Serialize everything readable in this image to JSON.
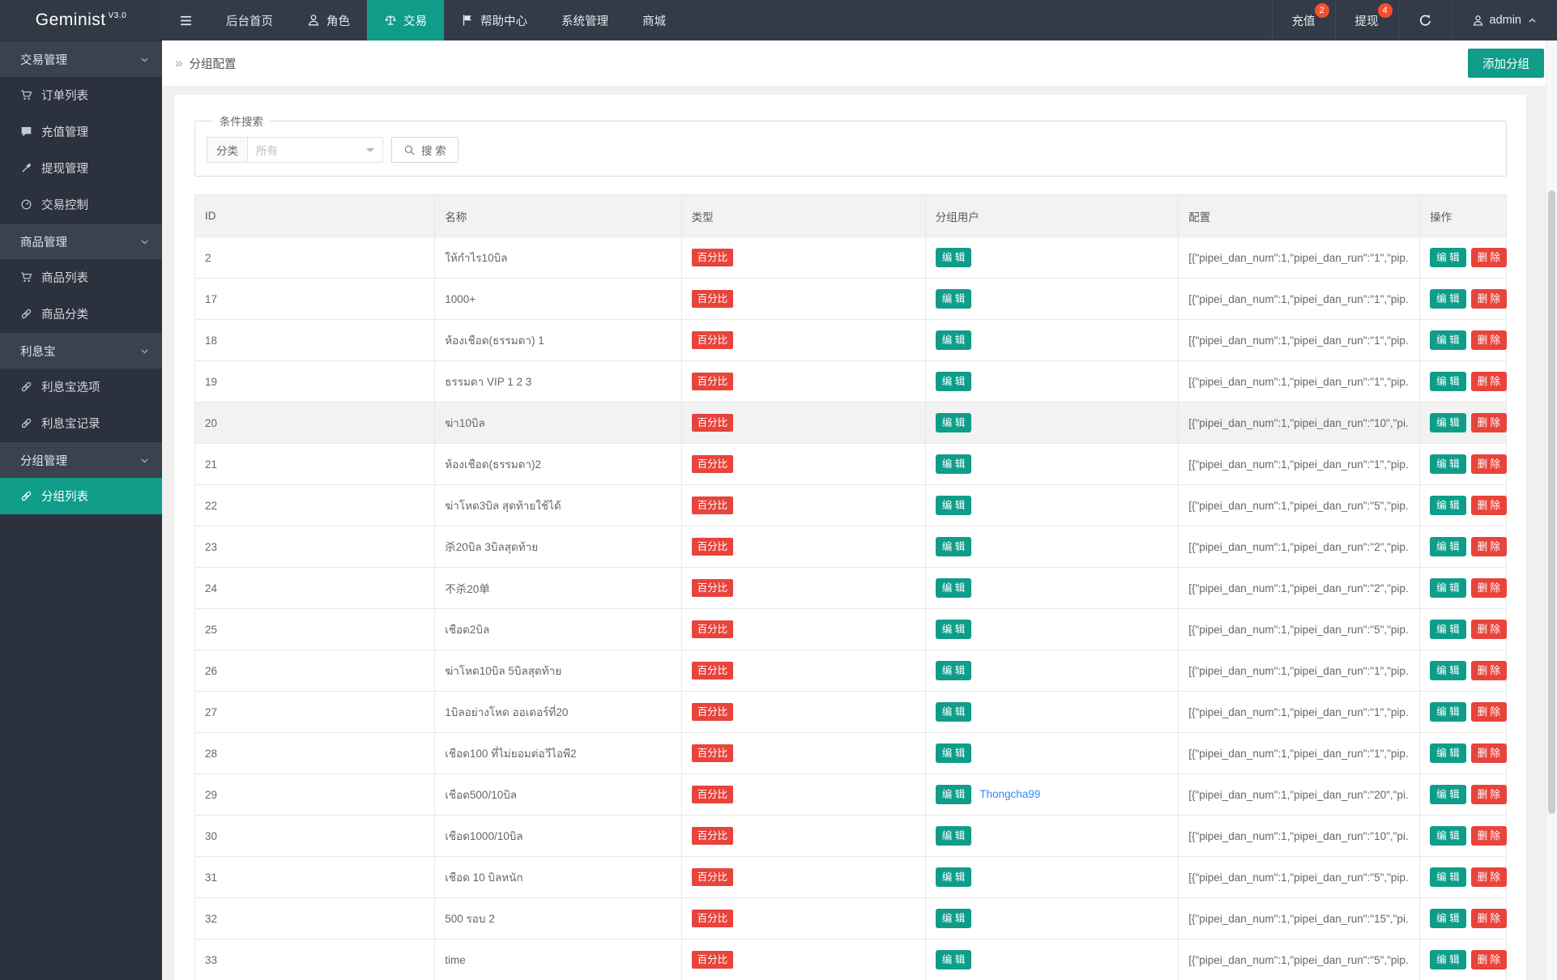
{
  "colors": {
    "accent_teal": "#0f9d8a",
    "danger_red": "#e8443c",
    "badge_orange": "#f4502c",
    "link_blue": "#2d8cf0"
  },
  "navbar": {
    "logo": "Geminist",
    "version": "V3.0",
    "menu": [
      {
        "key": "dashboard",
        "label": "后台首页",
        "icon": "",
        "active": false
      },
      {
        "key": "roles",
        "label": "角色",
        "icon": "user",
        "active": false
      },
      {
        "key": "trade",
        "label": "交易",
        "icon": "scales",
        "active": true
      },
      {
        "key": "help-center",
        "label": "帮助中心",
        "icon": "flag",
        "active": false
      },
      {
        "key": "system",
        "label": "系统管理",
        "icon": "",
        "active": false
      },
      {
        "key": "mall",
        "label": "商城",
        "icon": "",
        "active": false
      }
    ],
    "recharge_label": "充值",
    "recharge_badge": "2",
    "withdraw_label": "提现",
    "withdraw_badge": "4",
    "user": "admin"
  },
  "sidebar": {
    "groups": [
      {
        "key": "trade-mgmt",
        "title": "交易管理",
        "items": [
          {
            "key": "order-list",
            "label": "订单列表",
            "icon": "cart",
            "active": false
          },
          {
            "key": "recharge-mgmt",
            "label": "充值管理",
            "icon": "comment",
            "active": false
          },
          {
            "key": "withdraw-mgmt",
            "label": "提现管理",
            "icon": "gavel",
            "active": false
          },
          {
            "key": "trade-control",
            "label": "交易控制",
            "icon": "gauge",
            "active": false
          }
        ]
      },
      {
        "key": "goods-mgmt",
        "title": "商品管理",
        "items": [
          {
            "key": "goods-list",
            "label": "商品列表",
            "icon": "cart",
            "active": false
          },
          {
            "key": "goods-category",
            "label": "商品分类",
            "icon": "link",
            "active": false
          }
        ]
      },
      {
        "key": "lixibao",
        "title": "利息宝",
        "items": [
          {
            "key": "lixibao-options",
            "label": "利息宝选项",
            "icon": "link",
            "active": false
          },
          {
            "key": "lixibao-records",
            "label": "利息宝记录",
            "icon": "link",
            "active": false
          }
        ]
      },
      {
        "key": "group-mgmt",
        "title": "分组管理",
        "items": [
          {
            "key": "group-list",
            "label": "分组列表",
            "icon": "link",
            "active": true
          }
        ]
      }
    ]
  },
  "page": {
    "breadcrumb_arrow": "»",
    "breadcrumb": "分组配置",
    "add_button": "添加分组"
  },
  "search": {
    "legend": "条件搜索",
    "category_label": "分类",
    "category_value": "所有",
    "button_label": "搜 索"
  },
  "table": {
    "headers": [
      "ID",
      "名称",
      "类型",
      "分组用户",
      "配置",
      "操作"
    ],
    "col_widths_pct": [
      18.3,
      18.8,
      18.6,
      19.3,
      18.4,
      6.6
    ],
    "type_badge": "百分比",
    "edit_label": "编 辑",
    "delete_label": "删 除",
    "rows": [
      {
        "id": "2",
        "name": "ให้กำไร10บิล",
        "config": "[{\"pipei_dan_num\":1,\"pipei_dan_run\":\"1\",\"pip...",
        "user_link": "",
        "highlight": false
      },
      {
        "id": "17",
        "name": "1000+",
        "config": "[{\"pipei_dan_num\":1,\"pipei_dan_run\":\"1\",\"pip...",
        "user_link": "",
        "highlight": false
      },
      {
        "id": "18",
        "name": "ห้องเชือด(ธรรมดา) 1",
        "config": "[{\"pipei_dan_num\":1,\"pipei_dan_run\":\"1\",\"pip...",
        "user_link": "",
        "highlight": false
      },
      {
        "id": "19",
        "name": "ธรรมดา VIP 1 2 3",
        "config": "[{\"pipei_dan_num\":1,\"pipei_dan_run\":\"1\",\"pip...",
        "user_link": "",
        "highlight": false
      },
      {
        "id": "20",
        "name": "ฆ่า10บิล",
        "config": "[{\"pipei_dan_num\":1,\"pipei_dan_run\":\"10\",\"pi...",
        "user_link": "",
        "highlight": true
      },
      {
        "id": "21",
        "name": "ห้องเชือด(ธรรมดา)2",
        "config": "[{\"pipei_dan_num\":1,\"pipei_dan_run\":\"1\",\"pip...",
        "user_link": "",
        "highlight": false
      },
      {
        "id": "22",
        "name": "ฆ่าโหด3บิล สุดท้ายใช้ได้",
        "config": "[{\"pipei_dan_num\":1,\"pipei_dan_run\":\"5\",\"pip...",
        "user_link": "",
        "highlight": false
      },
      {
        "id": "23",
        "name": "杀20บิล 3บิลสุดท้าย",
        "config": "[{\"pipei_dan_num\":1,\"pipei_dan_run\":\"2\",\"pip...",
        "user_link": "",
        "highlight": false
      },
      {
        "id": "24",
        "name": "不杀20单",
        "config": "[{\"pipei_dan_num\":1,\"pipei_dan_run\":\"2\",\"pip...",
        "user_link": "",
        "highlight": false
      },
      {
        "id": "25",
        "name": "เชือด2บิล",
        "config": "[{\"pipei_dan_num\":1,\"pipei_dan_run\":\"5\",\"pip...",
        "user_link": "",
        "highlight": false
      },
      {
        "id": "26",
        "name": "ฆ่าโหด10บิล 5บิลสุดท้าย",
        "config": "[{\"pipei_dan_num\":1,\"pipei_dan_run\":\"1\",\"pip...",
        "user_link": "",
        "highlight": false
      },
      {
        "id": "27",
        "name": "1บิลอย่างโหด ออเดอร์ที่20",
        "config": "[{\"pipei_dan_num\":1,\"pipei_dan_run\":\"1\",\"pip...",
        "user_link": "",
        "highlight": false
      },
      {
        "id": "28",
        "name": "เชือด100 ที่ไม่ยอมต่อวีไอพี2",
        "config": "[{\"pipei_dan_num\":1,\"pipei_dan_run\":\"1\",\"pip...",
        "user_link": "",
        "highlight": false
      },
      {
        "id": "29",
        "name": "เชือด500/10บิล",
        "config": "[{\"pipei_dan_num\":1,\"pipei_dan_run\":\"20\",\"pi...",
        "user_link": "Thongcha99",
        "highlight": false
      },
      {
        "id": "30",
        "name": "เชือด1000/10บิล",
        "config": "[{\"pipei_dan_num\":1,\"pipei_dan_run\":\"10\",\"pi...",
        "user_link": "",
        "highlight": false
      },
      {
        "id": "31",
        "name": "เชือด 10 บิลหนัก",
        "config": "[{\"pipei_dan_num\":1,\"pipei_dan_run\":\"5\",\"pip...",
        "user_link": "",
        "highlight": false
      },
      {
        "id": "32",
        "name": "500 รอบ 2",
        "config": "[{\"pipei_dan_num\":1,\"pipei_dan_run\":\"15\",\"pi...",
        "user_link": "",
        "highlight": false
      },
      {
        "id": "33",
        "name": "time",
        "config": "[{\"pipei_dan_num\":1,\"pipei_dan_run\":\"5\",\"pip...",
        "user_link": "",
        "highlight": false
      }
    ]
  }
}
